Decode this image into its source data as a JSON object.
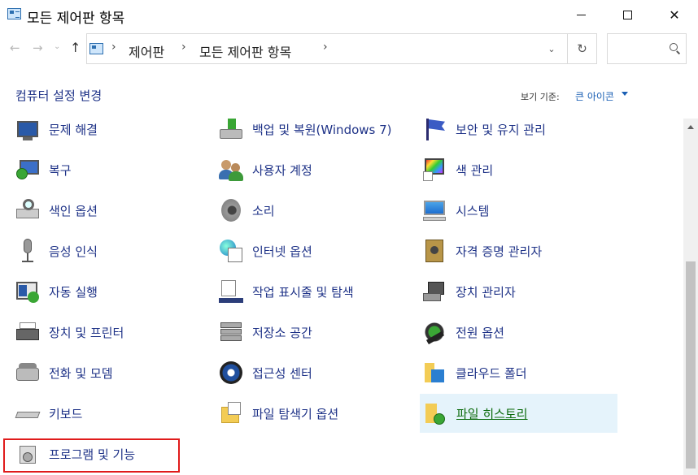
{
  "window": {
    "title": "모든 제어판 항목",
    "minimize_glyph": "",
    "maximize_glyph": "",
    "close_glyph": "✕"
  },
  "nav": {
    "back_glyph": "←",
    "forward_glyph": "→",
    "recent_glyph": "⌄",
    "up_glyph": "↑",
    "breadcrumbs": [
      "제어판",
      "모든 제어판 항목"
    ],
    "sep_glyph": "›",
    "dropdown_glyph": "⌄",
    "refresh_glyph": "↻",
    "search_placeholder": ""
  },
  "header": {
    "heading": "컴퓨터 설정 변경",
    "view_by_label": "보기 기준:",
    "view_by_value": "큰 아이콘"
  },
  "items": [
    {
      "label": "문제 해결",
      "icon": "troubleshooting-icon"
    },
    {
      "label": "백업 및 복원(Windows 7)",
      "icon": "backup-restore-icon"
    },
    {
      "label": "보안 및 유지 관리",
      "icon": "security-maintenance-flag-icon"
    },
    {
      "label": "복구",
      "icon": "recovery-icon"
    },
    {
      "label": "사용자 계정",
      "icon": "user-accounts-icon"
    },
    {
      "label": "색 관리",
      "icon": "color-management-icon"
    },
    {
      "label": "색인 옵션",
      "icon": "indexing-options-icon"
    },
    {
      "label": "소리",
      "icon": "speaker-icon"
    },
    {
      "label": "시스템",
      "icon": "system-monitor-icon"
    },
    {
      "label": "음성 인식",
      "icon": "microphone-icon"
    },
    {
      "label": "인터넷 옵션",
      "icon": "internet-options-icon"
    },
    {
      "label": "자격 증명 관리자",
      "icon": "credential-manager-icon"
    },
    {
      "label": "자동 실행",
      "icon": "autoplay-icon"
    },
    {
      "label": "작업 표시줄 및 탐색",
      "icon": "taskbar-navigation-icon"
    },
    {
      "label": "장치 관리자",
      "icon": "device-manager-icon"
    },
    {
      "label": "장치 및 프린터",
      "icon": "devices-printers-icon"
    },
    {
      "label": "저장소 공간",
      "icon": "storage-spaces-icon"
    },
    {
      "label": "전원 옵션",
      "icon": "power-options-icon"
    },
    {
      "label": "전화 및 모뎀",
      "icon": "phone-modem-icon"
    },
    {
      "label": "접근성 센터",
      "icon": "ease-of-access-icon"
    },
    {
      "label": "클라우드 폴더",
      "icon": "cloud-folder-icon"
    },
    {
      "label": "키보드",
      "icon": "keyboard-icon"
    },
    {
      "label": "파일 탐색기 옵션",
      "icon": "file-explorer-options-icon"
    },
    {
      "label": "파일 히스토리",
      "icon": "file-history-icon"
    },
    {
      "label": "프로그램 및 기능",
      "icon": "programs-features-icon"
    }
  ],
  "colors": {
    "link": "#1e3287",
    "hover_bg": "#e5f3fb",
    "hover_text": "#0a6a0a",
    "highlight": "#e01b1b"
  }
}
